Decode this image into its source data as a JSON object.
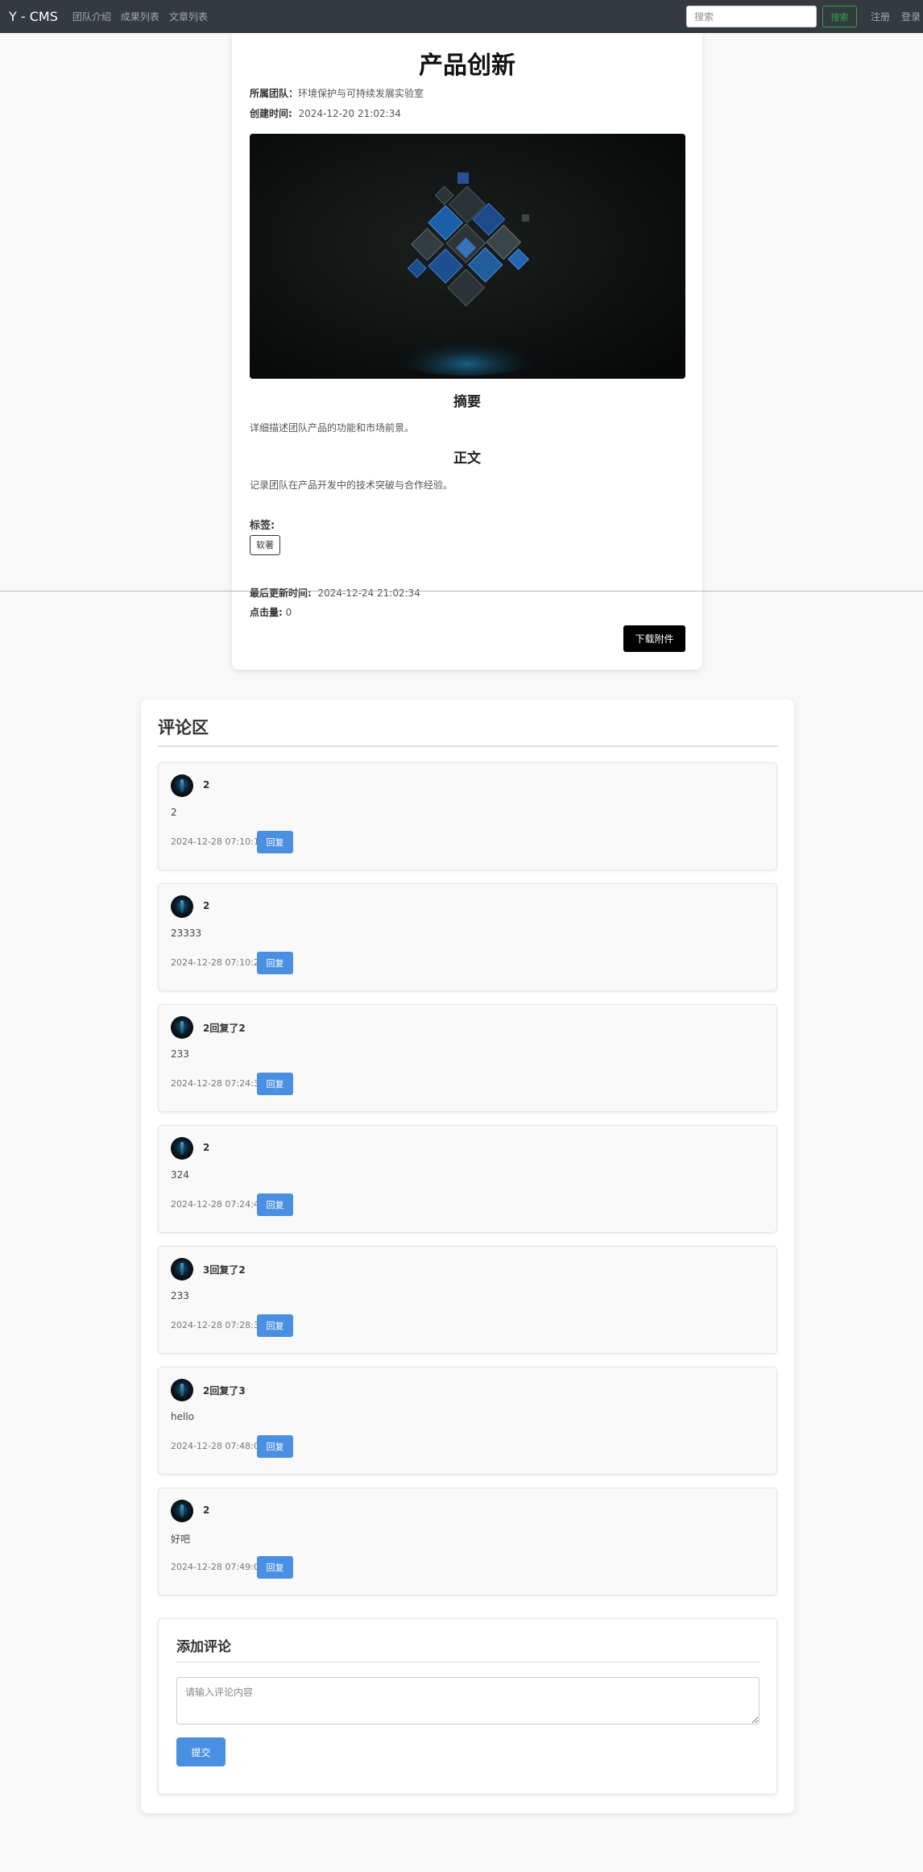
{
  "navbar": {
    "brand": "Y - CMS",
    "links": [
      "团队介绍",
      "成果列表",
      "文章列表"
    ],
    "search_placeholder": "搜索",
    "search_button": "搜索",
    "register": "注册",
    "login": "登录"
  },
  "article": {
    "title": "产品创新",
    "team_label": "所属团队：",
    "team_value": "环境保护与可持续发展实验室",
    "created_label": "创建时间:",
    "created_value": "2024-12-20 21:02:34",
    "summary_heading": "摘要",
    "summary_text": "详细描述团队产品的功能和市场前景。",
    "body_heading": "正文",
    "body_text": "记录团队在产品开发中的技术突破与合作经验。",
    "tags_label": "标签:",
    "tags": [
      "软著"
    ],
    "updated_label": "最后更新时间:",
    "updated_value": "2024-12-24 21:02:34",
    "views_label": "点击量:",
    "views_value": "0",
    "download_button": "下载附件"
  },
  "comments": {
    "title": "评论区",
    "reply_label": "回复",
    "items": [
      {
        "user": "2",
        "content": "2",
        "time": "2024-12-28 07:10:15"
      },
      {
        "user": "2",
        "content": "23333",
        "time": "2024-12-28 07:10:24"
      },
      {
        "user": "2回复了2",
        "content": "233",
        "time": "2024-12-28 07:24:36"
      },
      {
        "user": "2",
        "content": "324",
        "time": "2024-12-28 07:24:46"
      },
      {
        "user": "3回复了2",
        "content": "233",
        "time": "2024-12-28 07:28:30"
      },
      {
        "user": "2回复了3",
        "content": "hello",
        "time": "2024-12-28 07:48:08"
      },
      {
        "user": "2",
        "content": "好吧",
        "time": "2024-12-28 07:49:04"
      }
    ]
  },
  "add_comment": {
    "title": "添加评论",
    "placeholder": "请输入评论内容",
    "submit": "提交"
  }
}
